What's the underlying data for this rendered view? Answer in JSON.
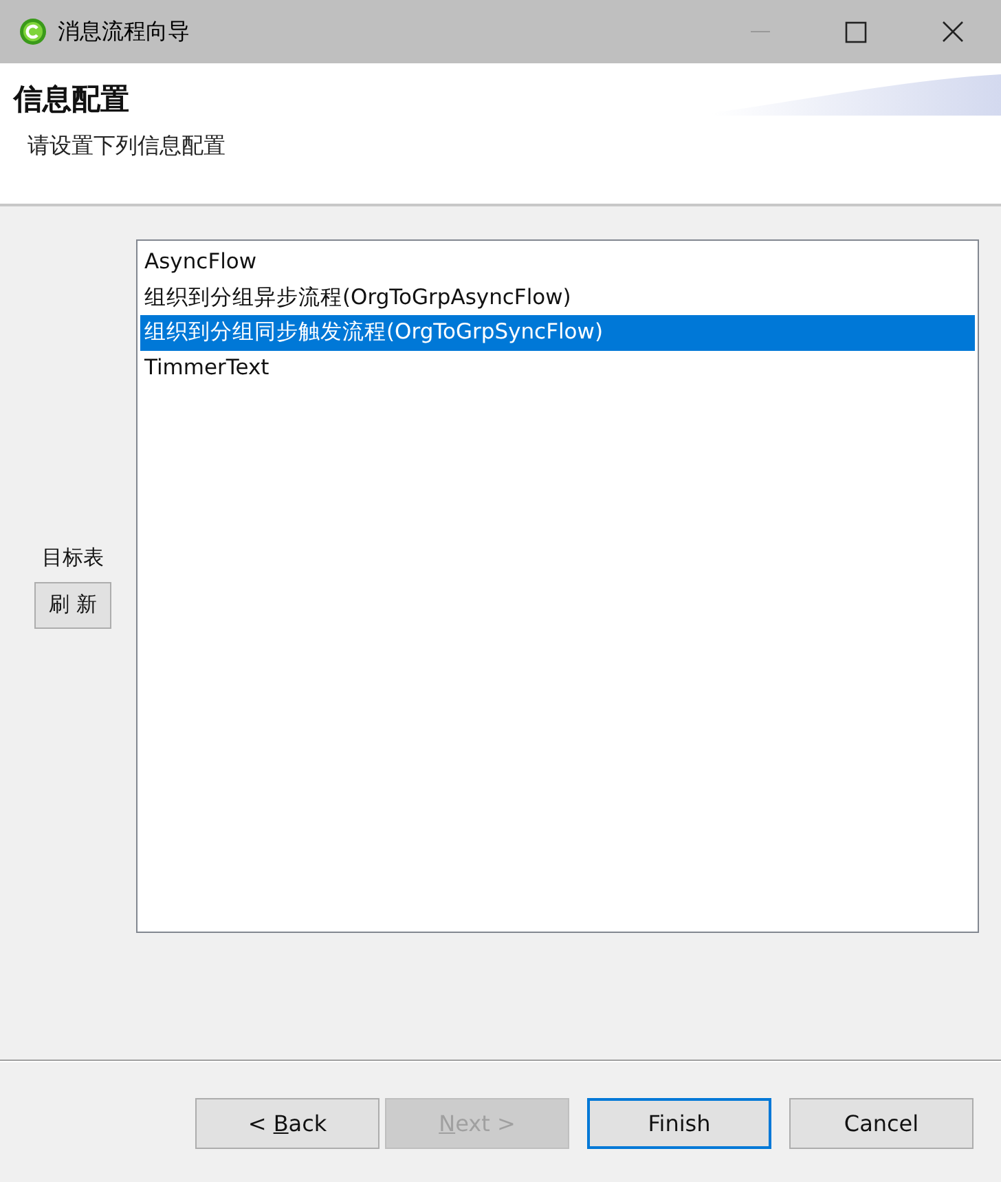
{
  "window": {
    "title": "消息流程向导"
  },
  "header": {
    "title": "信息配置",
    "subtitle": "请设置下列信息配置"
  },
  "target": {
    "label": "目标表",
    "refresh_button": "刷 新"
  },
  "list": {
    "items": [
      {
        "label": "AsyncFlow",
        "selected": false
      },
      {
        "label": "组织到分组异步流程(OrgToGrpAsyncFlow)",
        "selected": false
      },
      {
        "label": "组织到分组同步触发流程(OrgToGrpSyncFlow)",
        "selected": true
      },
      {
        "label": "TimmerText",
        "selected": false
      }
    ]
  },
  "buttons": [
    {
      "before": "< ",
      "mnemonic": "B",
      "after": "ack",
      "disabled": false,
      "default": false
    },
    {
      "mnemonic": "N",
      "after": "ext >",
      "disabled": true,
      "default": false
    },
    {
      "after": "Finish",
      "disabled": false,
      "default": true
    },
    {
      "after": "Cancel",
      "disabled": false,
      "default": false
    }
  ]
}
